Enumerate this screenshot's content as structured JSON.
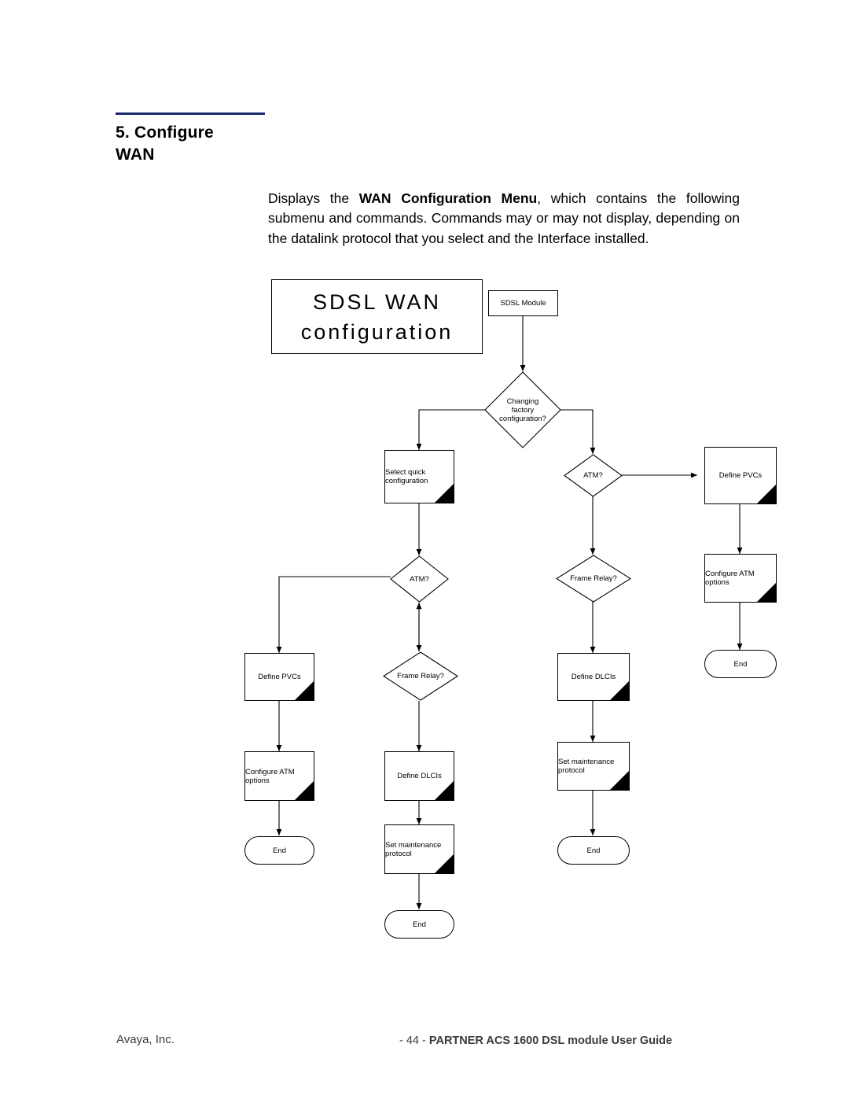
{
  "document": {
    "section_heading": {
      "line1": "5. Configure",
      "line2": "WAN"
    },
    "paragraph": {
      "before_bold": "Displays the ",
      "bold": "WAN Configuration Menu",
      "after_bold": ", which contains the following submenu and commands.  Commands may or may not display, depending on the datalink protocol that you select and the Interface installed."
    },
    "footer": {
      "left": "Avaya, Inc.",
      "page_number": "- 44 -",
      "right": "PARTNER ACS 1600 DSL module User Guide"
    },
    "accent_color": "#1a2a6c"
  },
  "flowchart": {
    "title_box": {
      "line1": "SDSL WAN",
      "line2": "configuration"
    },
    "nodes": [
      {
        "id": "sdsl-module",
        "label": "SDSL Module",
        "shape": "box"
      },
      {
        "id": "changing-factory-config",
        "label": "Changing\nfactory\nconfiguration?",
        "shape": "diamond"
      },
      {
        "id": "select-quick-configuration",
        "label": "Select quick\nconfiguration",
        "shape": "box-corner"
      },
      {
        "id": "atm-right",
        "label": "ATM?",
        "shape": "diamond"
      },
      {
        "id": "define-pvcs-right",
        "label": "Define PVCs",
        "shape": "box-corner"
      },
      {
        "id": "frame-relay-right",
        "label": "Frame Relay?",
        "shape": "diamond"
      },
      {
        "id": "configure-atm-options-right",
        "label": "Configure ATM\noptions",
        "shape": "box-corner"
      },
      {
        "id": "define-dlcis-right",
        "label": "Define DLCIs",
        "shape": "box-corner"
      },
      {
        "id": "end-right-top",
        "label": "End",
        "shape": "pill"
      },
      {
        "id": "set-maintenance-protocol-right",
        "label": "Set maintenance\nprotocol",
        "shape": "box-corner"
      },
      {
        "id": "end-right-bottom",
        "label": "End",
        "shape": "pill"
      },
      {
        "id": "atm-left",
        "label": "ATM?",
        "shape": "diamond"
      },
      {
        "id": "define-pvcs-left",
        "label": "Define PVCs",
        "shape": "box-corner"
      },
      {
        "id": "frame-relay-left",
        "label": "Frame Relay?",
        "shape": "diamond"
      },
      {
        "id": "configure-atm-options-left",
        "label": "Configure ATM\noptions",
        "shape": "box-corner"
      },
      {
        "id": "define-dlcis-left",
        "label": "Define DLCIs",
        "shape": "box-corner"
      },
      {
        "id": "end-left",
        "label": "End",
        "shape": "pill"
      },
      {
        "id": "set-maintenance-protocol-left",
        "label": "Set maintenance\nprotocol",
        "shape": "box-corner"
      },
      {
        "id": "end-center-bottom",
        "label": "End",
        "shape": "pill"
      }
    ]
  }
}
